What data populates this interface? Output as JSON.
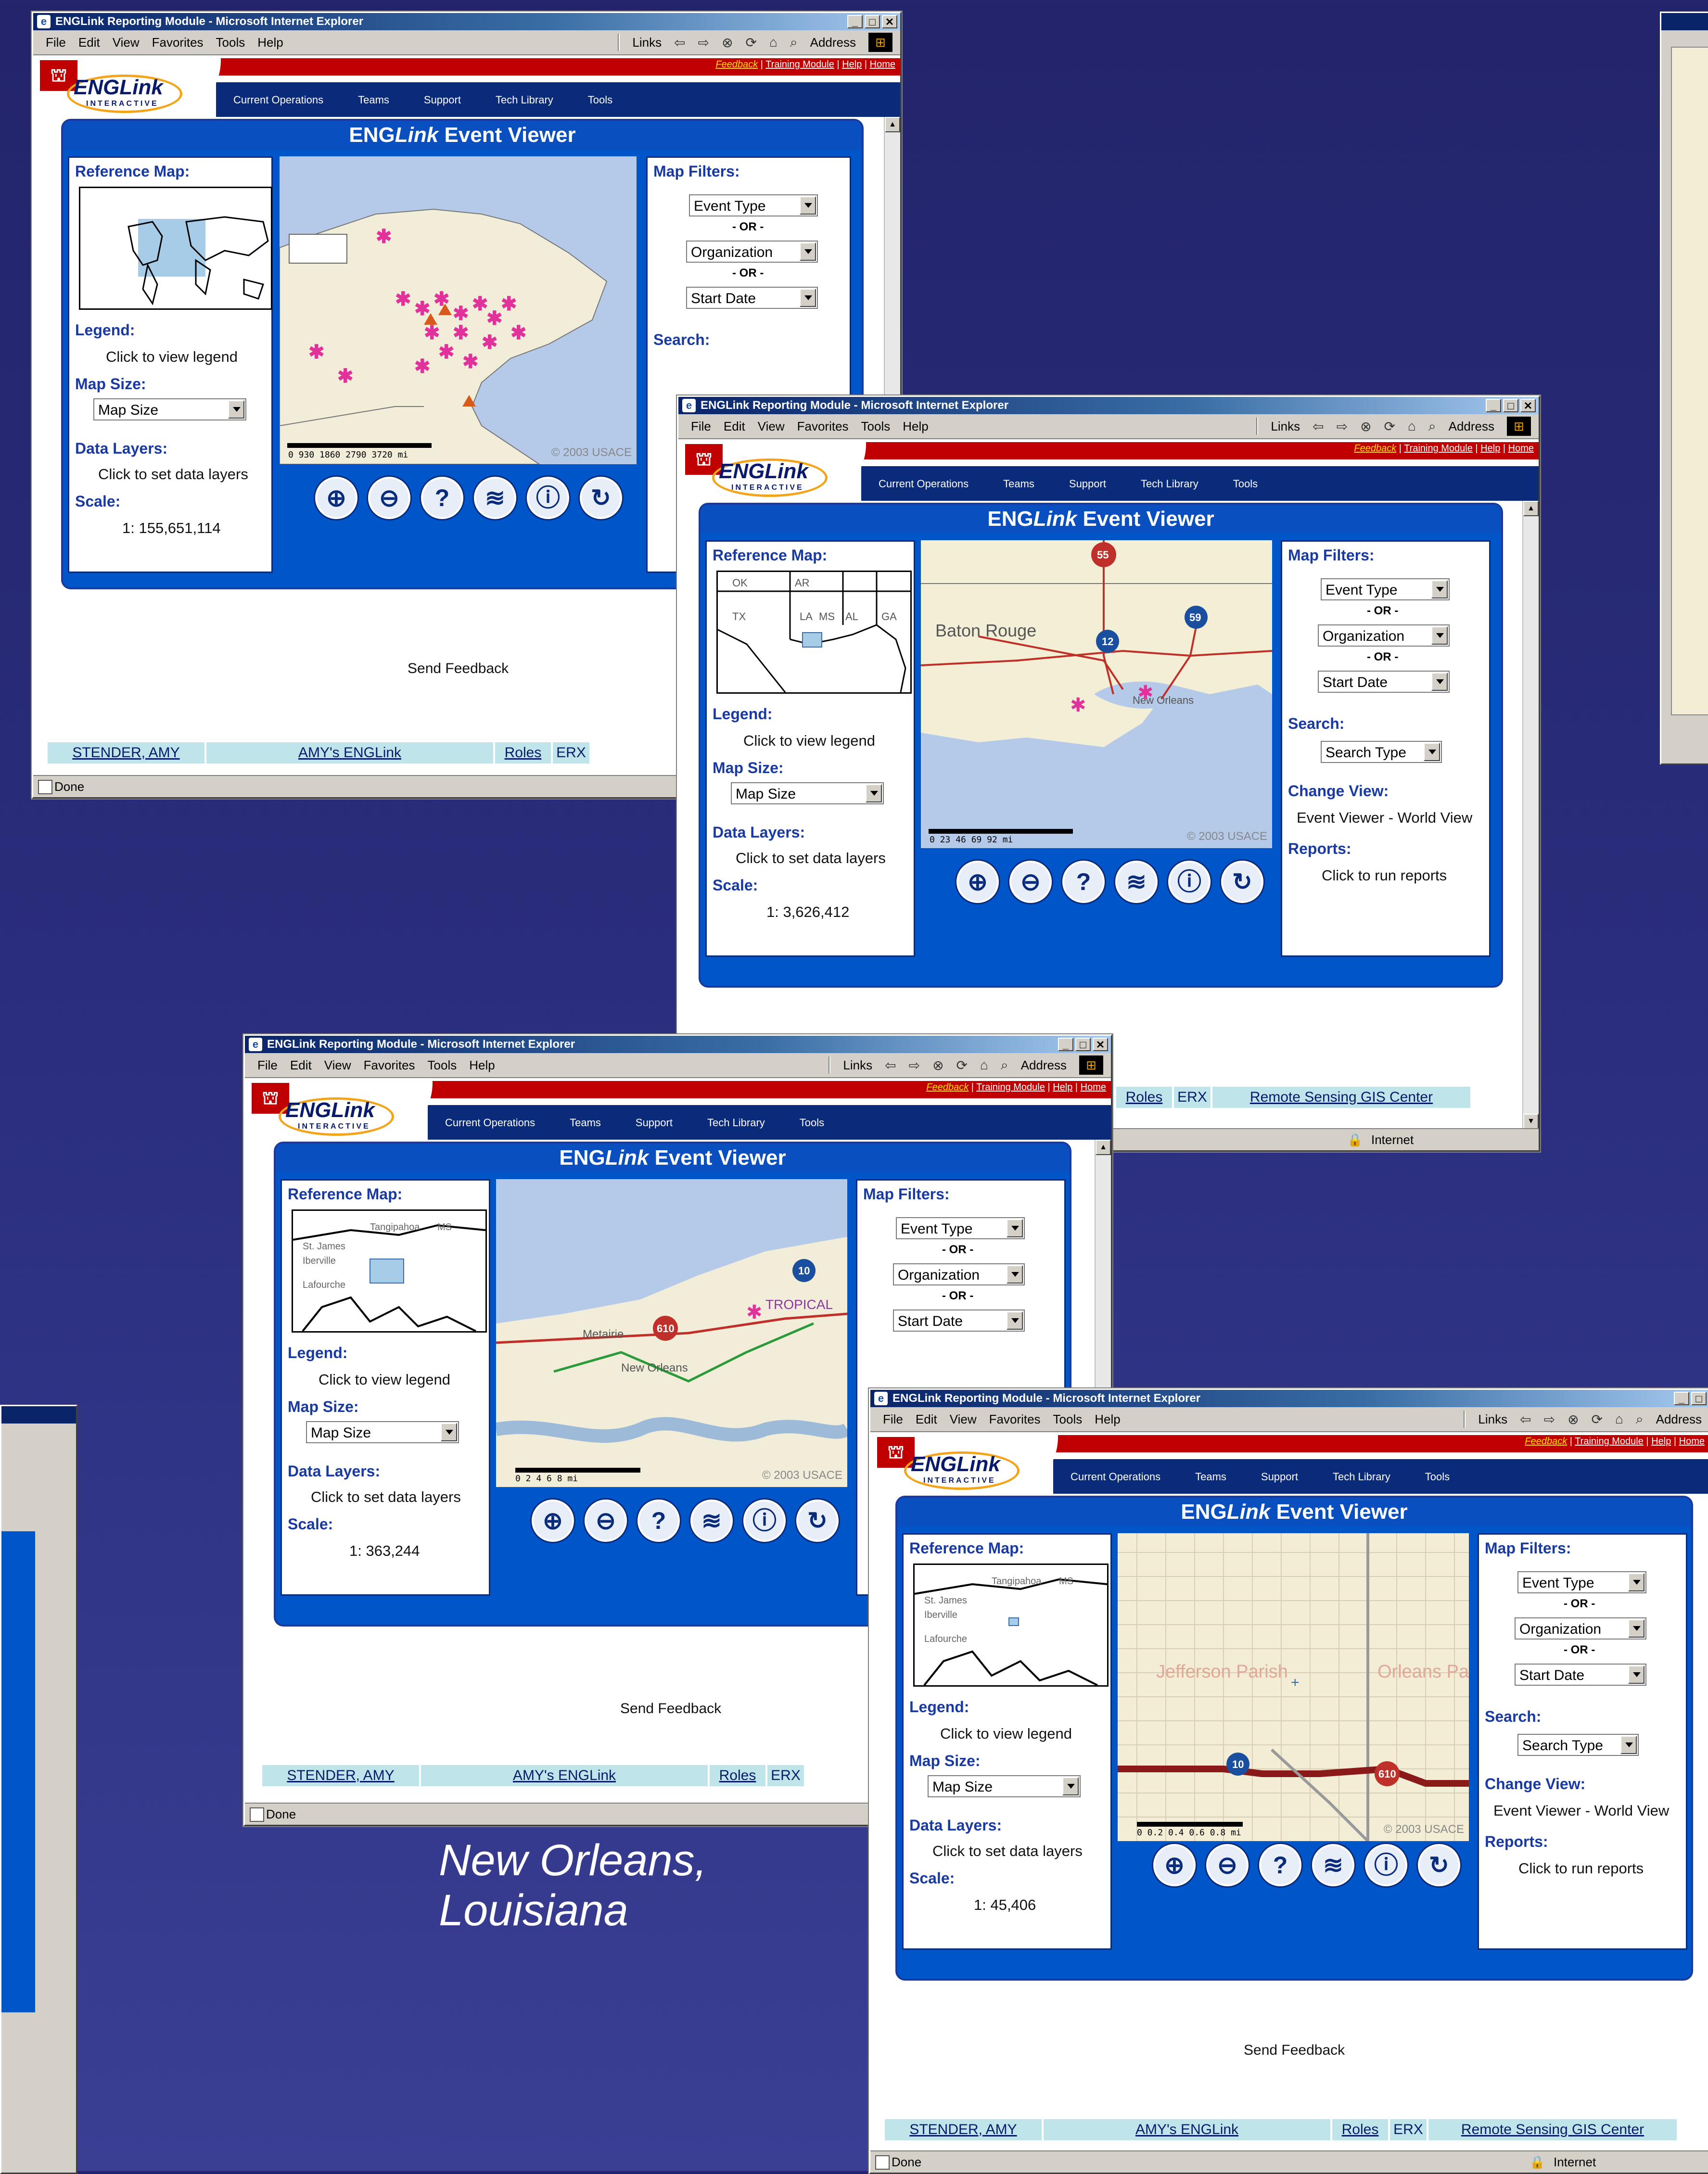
{
  "browser": {
    "title": "ENGLink Reporting Module - Microsoft Internet Explorer",
    "menu": [
      "File",
      "Edit",
      "View",
      "Favorites",
      "Tools",
      "Help"
    ],
    "links_label": "Links",
    "address_label": "Address",
    "status_done": "Done",
    "zone": "Internet"
  },
  "site": {
    "top_links": {
      "feedback": "Feedback",
      "training": "Training Module",
      "help": "Help",
      "home": "Home"
    },
    "nav": [
      "Current Operations",
      "Teams",
      "Support",
      "Tech Library",
      "Tools"
    ],
    "brand": "ENGLink",
    "brand_sub": "INTERACTIVE",
    "viewer_title_a": "ENG",
    "viewer_title_b": "Link",
    "viewer_title_c": " Event Viewer"
  },
  "viewer": {
    "reference_map": "Reference Map:",
    "legend": "Legend:",
    "legend_action": "Click to view legend",
    "map_size": "Map Size:",
    "map_size_select": "Map Size",
    "data_layers": "Data Layers:",
    "data_layers_action": "Click to set data layers",
    "scale": "Scale:",
    "map_filters": "Map Filters:",
    "filter_event_type": "Event Type",
    "or": "- OR -",
    "filter_organization": "Organization",
    "filter_start_date": "Start Date",
    "search": "Search:",
    "search_type": "Search Type",
    "change_view": "Change View:",
    "change_view_value": "Event Viewer - World View",
    "reports": "Reports:",
    "reports_action": "Click to run reports",
    "send_feedback": "Send Feedback",
    "copyright": "© 2003 USACE"
  },
  "footer": {
    "user": "STENDER, AMY",
    "my_englink": "AMY's ENGLink",
    "roles": "Roles",
    "erx": "ERX",
    "rs_gis": "Remote Sensing GIS Center"
  },
  "windows": [
    {
      "id": "world",
      "scale": "1: 155,651,114",
      "scalebar": "0   930  1860  2790  3720 mi"
    },
    {
      "id": "louisiana",
      "scale": "1: 3,626,412",
      "scalebar": "0    23    46    69    92 mi"
    },
    {
      "id": "new-orleans",
      "scale": "1: 363,244",
      "scalebar": "0    2    4    6    8 mi"
    },
    {
      "id": "metairie",
      "scale": "1: 45,406",
      "scalebar": "0  0.2  0.4  0.6  0.8 mi"
    }
  ],
  "map_labels": {
    "baton_rouge": "Baton Rouge",
    "new_orleans": "New Orleans",
    "metairie": "Metairie",
    "tropical": "TROPICAL",
    "jefferson": "Jefferson Parish",
    "orleans": "Orleans Parish"
  },
  "caption": {
    "line1": "New Orleans,",
    "line2": "Louisiana"
  },
  "colors": {
    "panel_blue": "#0056c8",
    "header_red": "#c00000",
    "navy": "#0a2a7a"
  }
}
